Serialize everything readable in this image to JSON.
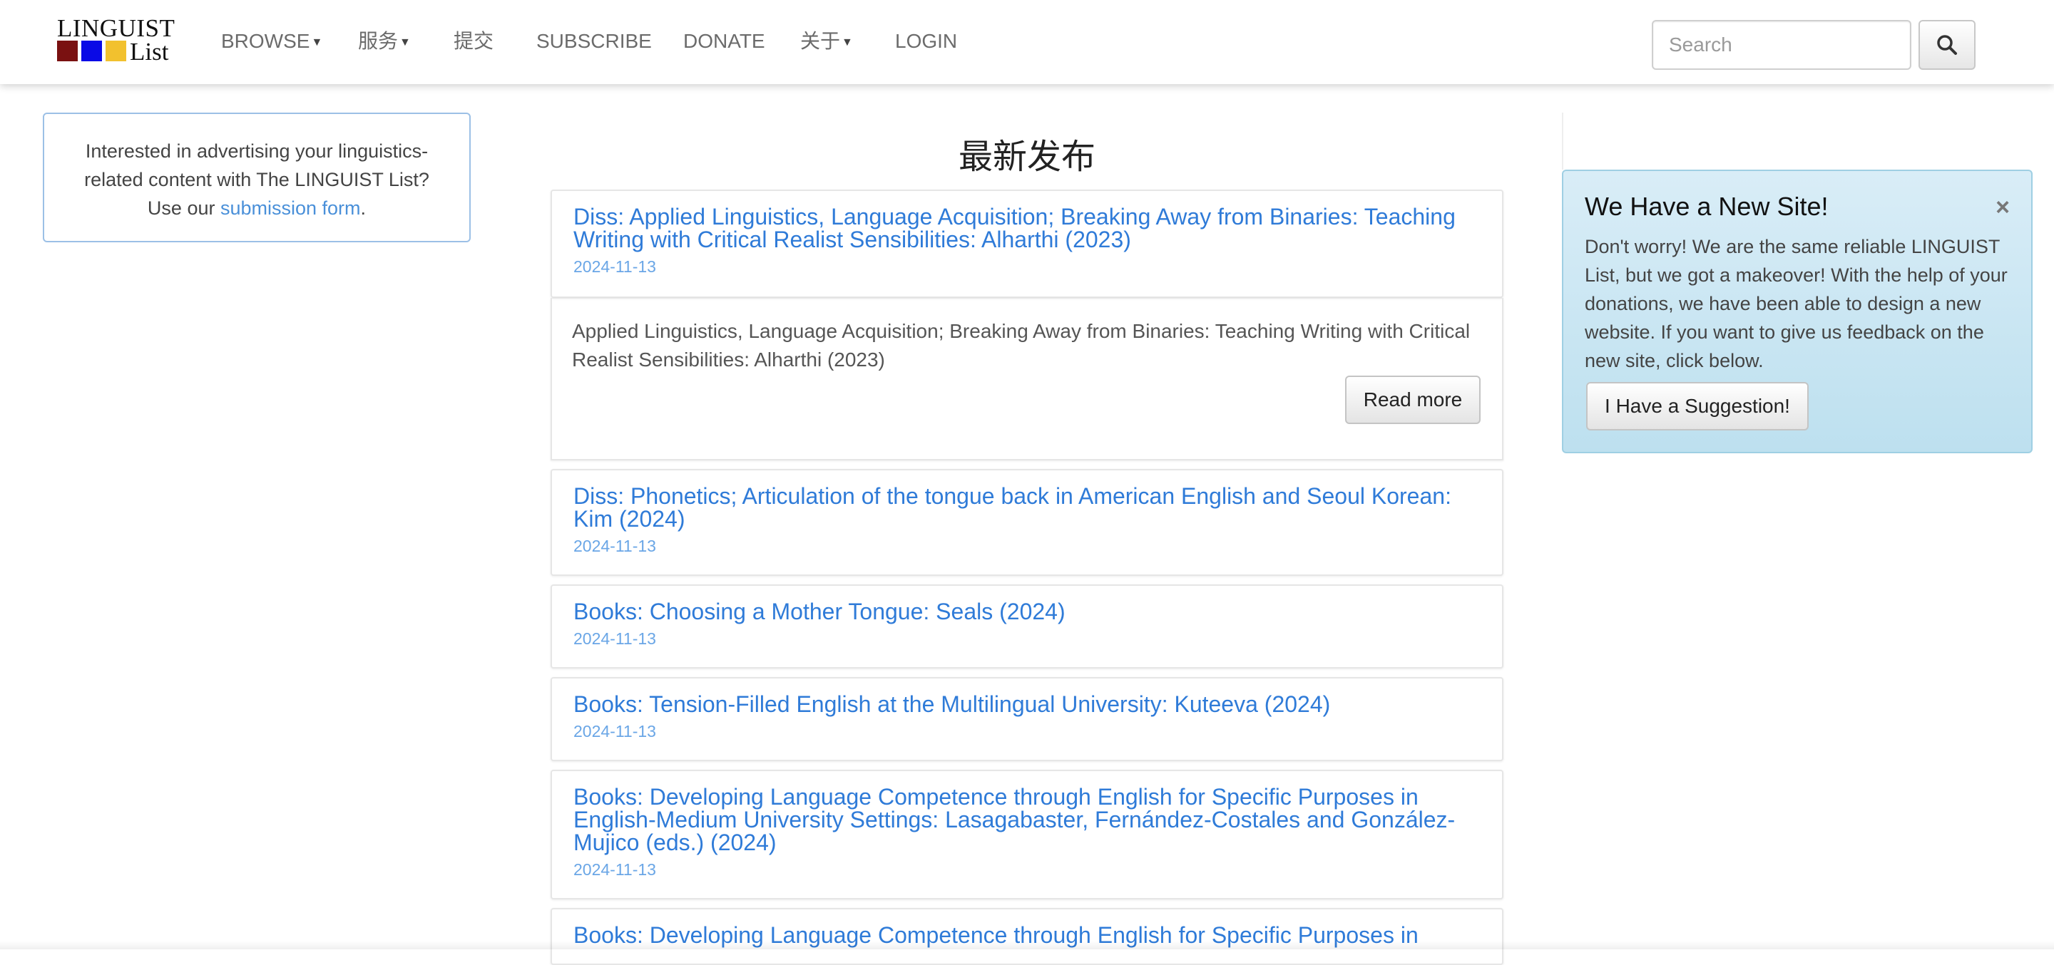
{
  "navbar": {
    "logo": {
      "line1": "LINGUIST",
      "line2": "List",
      "colors": [
        "#7a1111",
        "#0a0ae6",
        "#f2c12e"
      ]
    },
    "items": [
      {
        "label": "BROWSE",
        "dropdown": true
      },
      {
        "label": "服务",
        "dropdown": true
      },
      {
        "label": "提交",
        "dropdown": false
      },
      {
        "label": "SUBSCRIBE",
        "dropdown": false
      },
      {
        "label": "DONATE",
        "dropdown": false
      },
      {
        "label": "关于",
        "dropdown": true
      },
      {
        "label": "LOGIN",
        "dropdown": false
      }
    ],
    "search": {
      "placeholder": "Search",
      "icon": "search-icon"
    }
  },
  "ad_box": {
    "text": "Interested in advertising your linguistics-related content with The LINGUIST List? Use our",
    "link": "submission form",
    "after": "."
  },
  "main": {
    "title": "最新发布",
    "featured": {
      "title": "Diss: Applied Linguistics, Language Acquisition; Breaking Away from Binaries: Teaching Writing with Critical Realist Sensibilities: Alharthi (2023)",
      "date": "2024-11-13",
      "summary": "Applied Linguistics, Language Acquisition; Breaking Away from Binaries: Teaching Writing with Critical Realist Sensibilities: Alharthi (2023)",
      "read_more": "Read more"
    },
    "posts": [
      {
        "title": "Diss: Phonetics; Articulation of the tongue back in American English and Seoul Korean: Kim (2024)",
        "date": "2024-11-13"
      },
      {
        "title": "Books: Choosing a Mother Tongue: Seals (2024)",
        "date": "2024-11-13"
      },
      {
        "title": "Books: Tension-Filled English at the Multilingual University: Kuteeva (2024)",
        "date": "2024-11-13"
      },
      {
        "title": "Books: Developing Language Competence through English for Specific Purposes in English-Medium University Settings: Lasagabaster, Fernández-Costales and González-Mujico (eds.) (2024)",
        "date": "2024-11-13"
      },
      {
        "title": "Books: Developing Language Competence through English for Specific Purposes in",
        "date": ""
      }
    ]
  },
  "alert": {
    "title": "We Have a New Site!",
    "close": "×",
    "text": "Don't worry! We are the same reliable LINGUIST List, but we got a makeover! With the help of your donations, we have been able to design a new website. If you want to give us feedback on the new site, click below.",
    "button": "I Have a Suggestion!"
  },
  "colors": {
    "link": "#2f7bd8",
    "date": "#6aa6e6",
    "alert_bg": "#d9edf7"
  }
}
